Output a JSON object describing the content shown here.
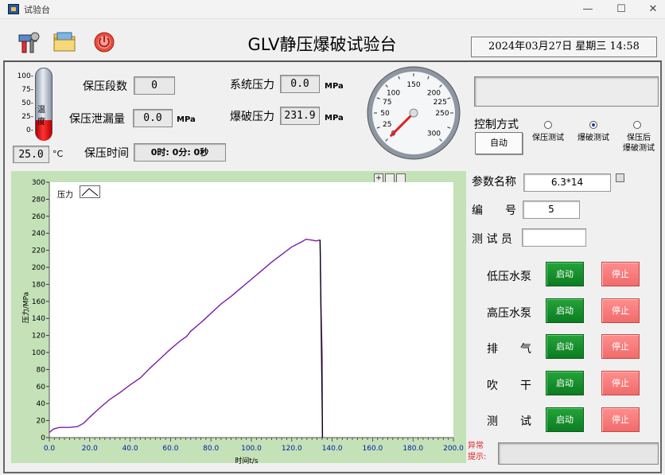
{
  "window": {
    "title": "试验台",
    "minimize": "—",
    "maximize": "☐",
    "close": "✕"
  },
  "header": {
    "title": "GLV静压爆破试验台",
    "datetime": "2024年03月27日 星期三 14:58"
  },
  "thermo": {
    "ticks": [
      "100-",
      "75-",
      "50-",
      "25-",
      "0-"
    ],
    "label": "温度",
    "value": "25.0",
    "unit": "°C",
    "fill_fraction": 0.28
  },
  "hold": {
    "segments_label": "保压段数",
    "segments_value": "0",
    "leak_label": "保压泄漏量",
    "leak_value": "0.0",
    "leak_unit": "MPa",
    "time_label": "保压时间",
    "time_value": "0时: 0分: 0秒"
  },
  "pressure": {
    "system_label": "系统压力",
    "system_value": "0.0",
    "system_unit": "MPa",
    "burst_label": "爆破压力",
    "burst_value": "231.9",
    "burst_unit": "MPa"
  },
  "gauge": {
    "ticks": [
      "0",
      "25",
      "50",
      "75",
      "100",
      "150",
      "200",
      "225",
      "250",
      "300"
    ],
    "value": 0
  },
  "control": {
    "mode_label": "控制方式",
    "mode_button": "自动",
    "options": [
      "保压测试",
      "爆破测试",
      "保压后\n爆破测试"
    ],
    "selected": 1
  },
  "params": {
    "name_label": "参数名称",
    "name_value": "6.3*14",
    "number_label": "编　　号",
    "number_value": "5",
    "tester_label": "测 试 员",
    "tester_value": ""
  },
  "devices": [
    {
      "label": "低压水泵",
      "start": "启动",
      "stop": "停止"
    },
    {
      "label": "高压水泵",
      "start": "启动",
      "stop": "停止"
    },
    {
      "label": "排　　气",
      "start": "启动",
      "stop": "停止"
    },
    {
      "label": "吹　　干",
      "start": "启动",
      "stop": "停止"
    },
    {
      "label": "测　　试",
      "start": "启动",
      "stop": "停止"
    }
  ],
  "alarm": {
    "label": "异常\n提示:",
    "value": ""
  },
  "chart_data": {
    "type": "line",
    "legend": "压力",
    "xlabel": "时间t/s",
    "ylabel": "压力/MPa",
    "xlim": [
      0,
      200
    ],
    "ylim": [
      0,
      300
    ],
    "x_ticks": [
      "0.0",
      "20.0",
      "40.0",
      "60.0",
      "80.0",
      "100.0",
      "120.0",
      "140.0",
      "160.0",
      "180.0",
      "200.0"
    ],
    "y_ticks": [
      "0",
      "20",
      "40",
      "60",
      "80",
      "100",
      "120",
      "140",
      "160",
      "180",
      "200",
      "220",
      "240",
      "260",
      "280",
      "300"
    ],
    "line_color": "#7b1fa2",
    "series": [
      {
        "x": [
          0,
          2,
          5,
          10,
          14,
          17,
          20,
          25,
          30,
          35,
          40,
          45,
          50,
          55,
          60,
          65,
          68,
          70,
          75,
          80,
          85,
          90,
          95,
          100,
          105,
          110,
          115,
          120,
          125,
          127,
          130,
          132,
          133,
          133.5,
          134,
          134.5,
          135,
          135.2
        ],
        "y": [
          6,
          10,
          12,
          12,
          13,
          17,
          24,
          35,
          45,
          53,
          62,
          70,
          82,
          93,
          104,
          114,
          119,
          125,
          135,
          146,
          157,
          166,
          176,
          186,
          196,
          206,
          215,
          224,
          230,
          233,
          232,
          231,
          231.5,
          232,
          232,
          150,
          97,
          0
        ]
      }
    ]
  }
}
